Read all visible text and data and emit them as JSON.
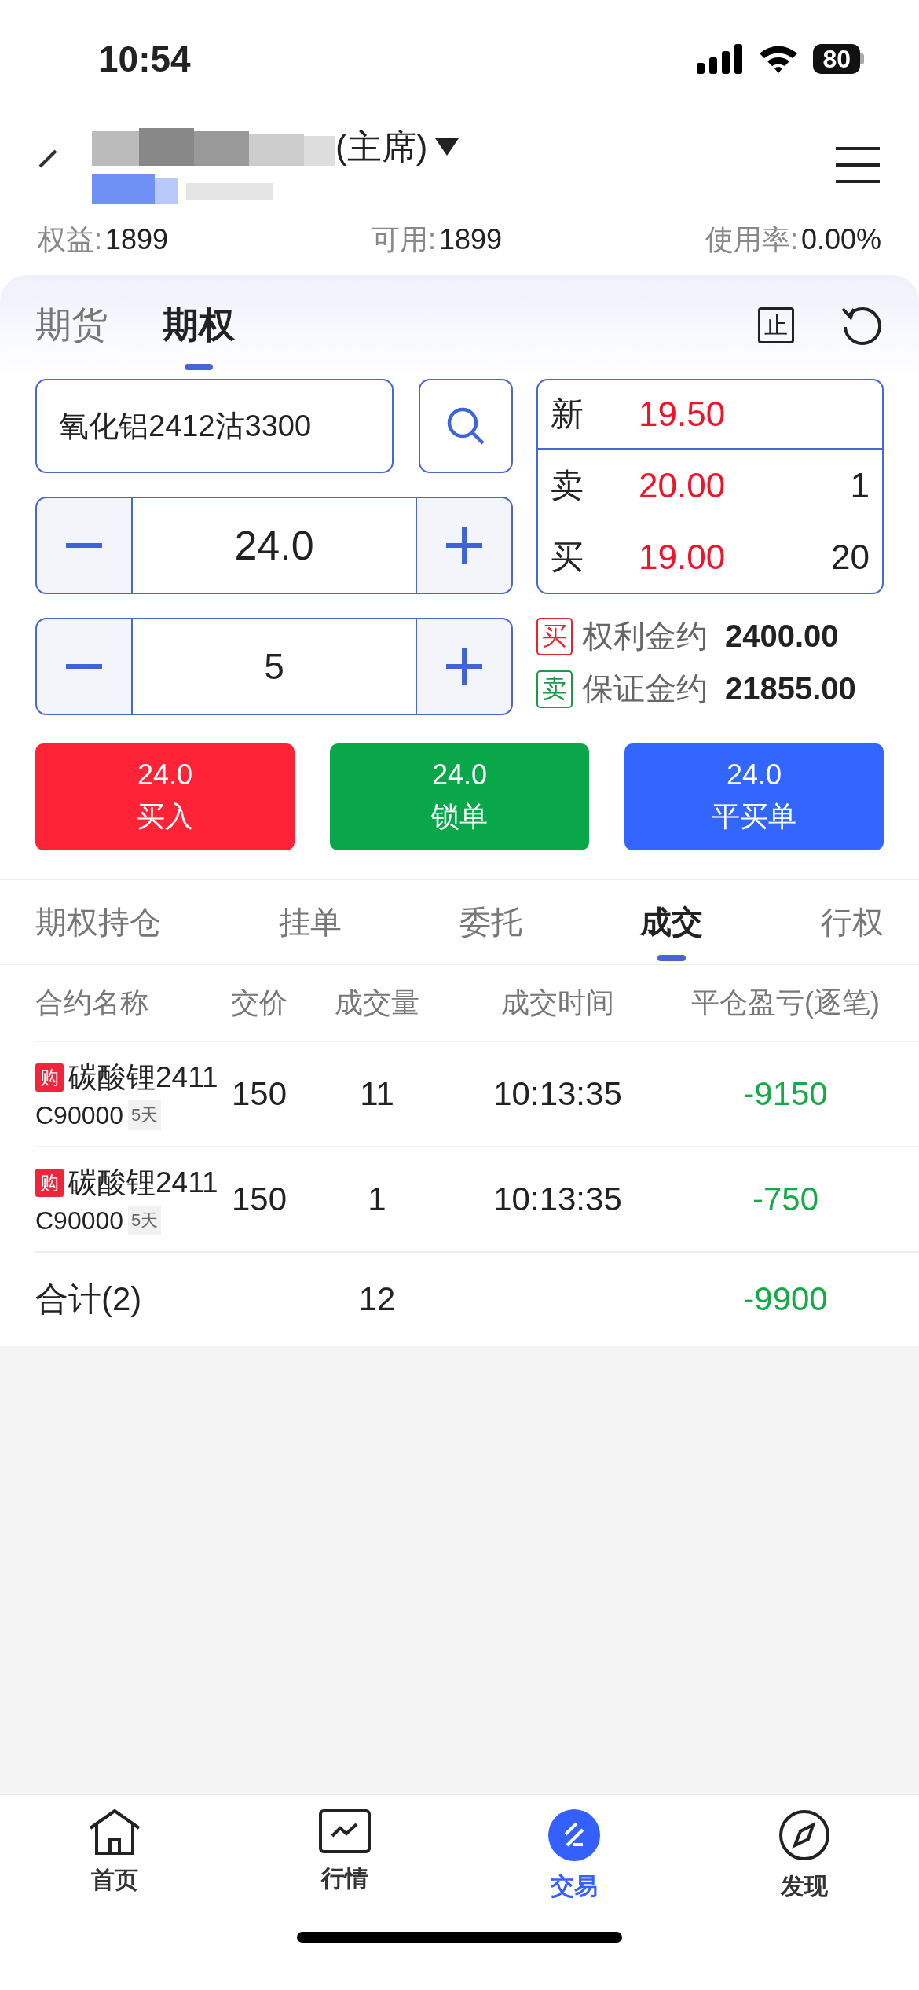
{
  "status_bar": {
    "time": "10:54",
    "battery": "80"
  },
  "header": {
    "title": "(主席)"
  },
  "account_stats": [
    {
      "label": "权益:",
      "value": "1899"
    },
    {
      "label": "可用:",
      "value": "1899"
    },
    {
      "label": "使用率:",
      "value": "0.00%"
    }
  ],
  "product_tabs": [
    {
      "label": "期货",
      "selected": false
    },
    {
      "label": "期权",
      "selected": true
    }
  ],
  "toolbar": {
    "stop_label": "止"
  },
  "order_form": {
    "contract": "氧化铝2412沽3300",
    "price": "24.0",
    "quantity": "5"
  },
  "quote": {
    "last": {
      "label": "新",
      "price": "19.50"
    },
    "ask": {
      "label": "卖",
      "price": "20.00",
      "volume": "1"
    },
    "bid": {
      "label": "买",
      "price": "19.00",
      "volume": "20"
    }
  },
  "estimates": [
    {
      "kind": "buy",
      "tag": "买",
      "label": "权利金约",
      "value": "2400.00"
    },
    {
      "kind": "sell",
      "tag": "卖",
      "label": "保证金约",
      "value": "21855.00"
    }
  ],
  "actions": [
    {
      "kind": "buy",
      "price": "24.0",
      "label": "买入"
    },
    {
      "kind": "lock",
      "price": "24.0",
      "label": "锁单"
    },
    {
      "kind": "close",
      "price": "24.0",
      "label": "平买单"
    }
  ],
  "record_tabs": [
    {
      "label": "期权持仓",
      "selected": false
    },
    {
      "label": "挂单",
      "selected": false
    },
    {
      "label": "委托",
      "selected": false
    },
    {
      "label": "成交",
      "selected": true
    },
    {
      "label": "行权",
      "selected": false
    }
  ],
  "table": {
    "columns": [
      "合约名称",
      "交价",
      "成交量",
      "成交时间",
      "平仓盈亏(逐笔)"
    ],
    "rows": [
      {
        "tag": "购",
        "name": "碳酸锂2411",
        "code": "C90000",
        "days": "5天",
        "price": "150",
        "volume": "11",
        "time": "10:13:35",
        "pnl": "-9150"
      },
      {
        "tag": "购",
        "name": "碳酸锂2411",
        "code": "C90000",
        "days": "5天",
        "price": "150",
        "volume": "1",
        "time": "10:13:35",
        "pnl": "-750"
      }
    ],
    "total": {
      "label": "合计(2)",
      "volume": "12",
      "pnl": "-9900"
    }
  },
  "nav": [
    {
      "kind": "home",
      "label": "首页",
      "selected": false
    },
    {
      "kind": "market",
      "label": "行情",
      "selected": false
    },
    {
      "kind": "trade",
      "label": "交易",
      "selected": true
    },
    {
      "kind": "discover",
      "label": "发现",
      "selected": false
    }
  ]
}
